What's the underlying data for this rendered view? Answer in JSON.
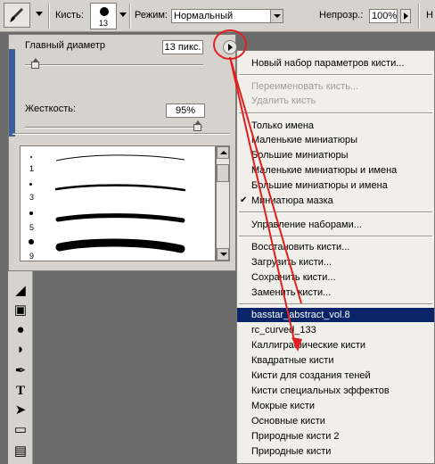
{
  "options_bar": {
    "brush_label": "Кисть:",
    "brush_size": "13",
    "mode_label": "Режим:",
    "mode_value": "Нормальный",
    "opacity_label": "Непрозр.:",
    "opacity_value": "100%",
    "right_label": "Н"
  },
  "brush_panel": {
    "diameter_label": "Главный диаметр",
    "diameter_value": "13 пикс.",
    "hardness_label": "Жесткость:",
    "hardness_value": "95%",
    "brushes": [
      {
        "size": "1",
        "stroke_width": 1
      },
      {
        "size": "3",
        "stroke_width": 2
      },
      {
        "size": "5",
        "stroke_width": 5
      },
      {
        "size": "9",
        "stroke_width": 9
      }
    ]
  },
  "menu": {
    "items": [
      {
        "label": "Новый набор параметров кисти...",
        "state": "normal"
      },
      {
        "label": "Переименовать кисть...",
        "state": "disabled"
      },
      {
        "label": "Удалить кисть",
        "state": "disabled"
      },
      {
        "label": "Только имена",
        "state": "normal"
      },
      {
        "label": "Маленькие миниатюры",
        "state": "normal"
      },
      {
        "label": "Большие миниатюры",
        "state": "normal"
      },
      {
        "label": "Маленькие миниатюры и имена",
        "state": "normal"
      },
      {
        "label": "Большие миниатюры и имена",
        "state": "normal"
      },
      {
        "label": "Миниатюра мазка",
        "state": "checked"
      },
      {
        "label": "Управление наборами...",
        "state": "normal"
      },
      {
        "label": "Восстановить кисти...",
        "state": "normal"
      },
      {
        "label": "Загрузить кисти...",
        "state": "normal"
      },
      {
        "label": "Сохранить кисти...",
        "state": "normal"
      },
      {
        "label": "Заменить кисти...",
        "state": "normal"
      },
      {
        "label": "basstar_abstract_vol.8",
        "state": "selected"
      },
      {
        "label": "rc_curved_133",
        "state": "normal"
      },
      {
        "label": "Каллиграфические кисти",
        "state": "normal"
      },
      {
        "label": "Квадратные кисти",
        "state": "normal"
      },
      {
        "label": "Кисти для создания теней",
        "state": "normal"
      },
      {
        "label": "Кисти специальных эффектов",
        "state": "normal"
      },
      {
        "label": "Мокрые кисти",
        "state": "normal"
      },
      {
        "label": "Основные кисти",
        "state": "normal"
      },
      {
        "label": "Природные кисти 2",
        "state": "normal"
      },
      {
        "label": "Природные кисти",
        "state": "normal"
      }
    ]
  },
  "colors": {
    "highlight": "#0a246a",
    "annotation": "#e02020"
  }
}
